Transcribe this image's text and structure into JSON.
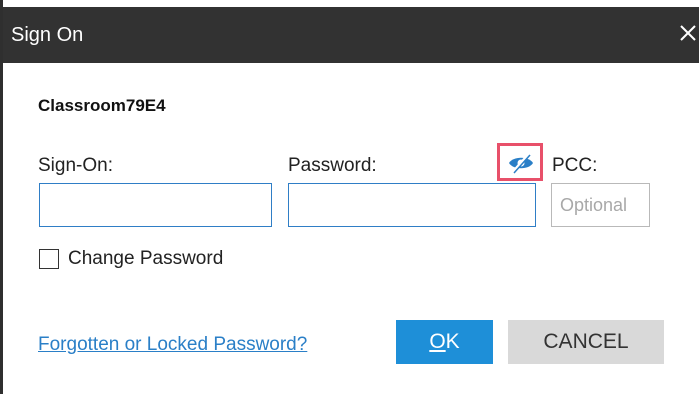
{
  "window": {
    "title": "Sign On",
    "close_label": "X"
  },
  "form": {
    "station_name": "Classroom79E4",
    "signon_label": "Sign-On:",
    "signon_value": "",
    "password_label": "Password:",
    "password_value": "",
    "pcc_label": "PCC:",
    "pcc_placeholder": "Optional",
    "show_password_icon": "eye-slash-icon",
    "change_password_label": "Change Password",
    "change_password_checked": false
  },
  "footer": {
    "forgot_link": "Forgotten or Locked Password?",
    "ok_mnemonic": "O",
    "ok_rest": "K",
    "cancel_label": "CANCEL"
  },
  "colors": {
    "titlebar": "#323232",
    "accent": "#1e8fd8",
    "link": "#2a7fc7",
    "highlight": "#e8506a",
    "cancel_bg": "#d9d9d9"
  }
}
